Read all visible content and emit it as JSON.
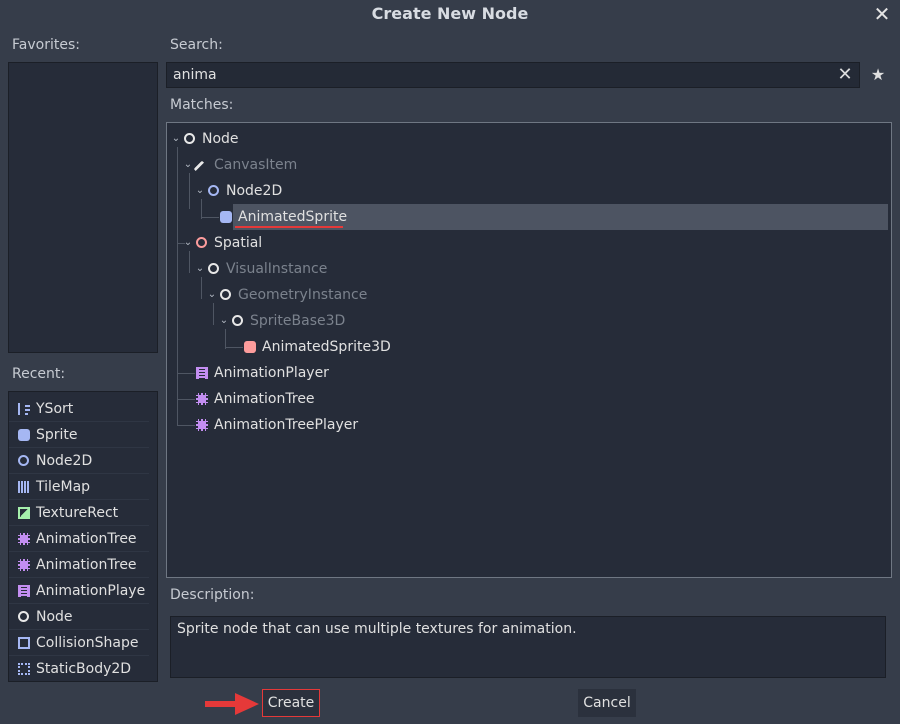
{
  "dialog": {
    "title": "Create New Node",
    "close_glyph": "✕"
  },
  "favorites": {
    "label": "Favorites:"
  },
  "recent": {
    "label": "Recent:",
    "items": [
      {
        "label": "YSort",
        "icon": "ysort-icon"
      },
      {
        "label": "Sprite",
        "icon": "sprite-icon"
      },
      {
        "label": "Node2D",
        "icon": "node2d-icon"
      },
      {
        "label": "TileMap",
        "icon": "tilemap-icon"
      },
      {
        "label": "TextureRect",
        "icon": "texturerect-icon"
      },
      {
        "label": "AnimationTree",
        "icon": "animationtree-icon"
      },
      {
        "label": "AnimationTree",
        "icon": "animationtree-icon"
      },
      {
        "label": "AnimationPlaye",
        "icon": "animationplayer-icon"
      },
      {
        "label": "Node",
        "icon": "node-icon"
      },
      {
        "label": "CollisionShape",
        "icon": "collisionshape-icon"
      },
      {
        "label": "StaticBody2D",
        "icon": "staticbody2d-icon"
      }
    ]
  },
  "search": {
    "label": "Search:",
    "value": "anima",
    "clear_glyph": "✕",
    "favorite_glyph": "★"
  },
  "matches": {
    "label": "Matches:",
    "nodes": [
      {
        "label": "Node",
        "icon": "node-icon",
        "dim": false
      },
      {
        "label": "CanvasItem",
        "icon": "canvasitem-icon",
        "dim": true
      },
      {
        "label": "Node2D",
        "icon": "node2d-icon",
        "dim": false
      },
      {
        "label": "AnimatedSprite",
        "icon": "animatedsprite-icon",
        "dim": false,
        "selected": true
      },
      {
        "label": "Spatial",
        "icon": "spatial-icon",
        "dim": false
      },
      {
        "label": "VisualInstance",
        "icon": "visualinstance-icon",
        "dim": true
      },
      {
        "label": "GeometryInstance",
        "icon": "geometryinstance-icon",
        "dim": true
      },
      {
        "label": "SpriteBase3D",
        "icon": "spritebase3d-icon",
        "dim": true
      },
      {
        "label": "AnimatedSprite3D",
        "icon": "animatedsprite3d-icon",
        "dim": false
      },
      {
        "label": "AnimationPlayer",
        "icon": "animationplayer-icon",
        "dim": false
      },
      {
        "label": "AnimationTree",
        "icon": "animationtree-icon",
        "dim": false
      },
      {
        "label": "AnimationTreePlayer",
        "icon": "animationtreeplayer-icon",
        "dim": false
      }
    ]
  },
  "description": {
    "label": "Description:",
    "text": "Sprite node that can use multiple textures for animation."
  },
  "buttons": {
    "create": "Create",
    "cancel": "Cancel"
  },
  "colors": {
    "background": "#363d4a",
    "panel": "#262c39",
    "highlight": "#e53939",
    "selection": "#4d5462"
  }
}
